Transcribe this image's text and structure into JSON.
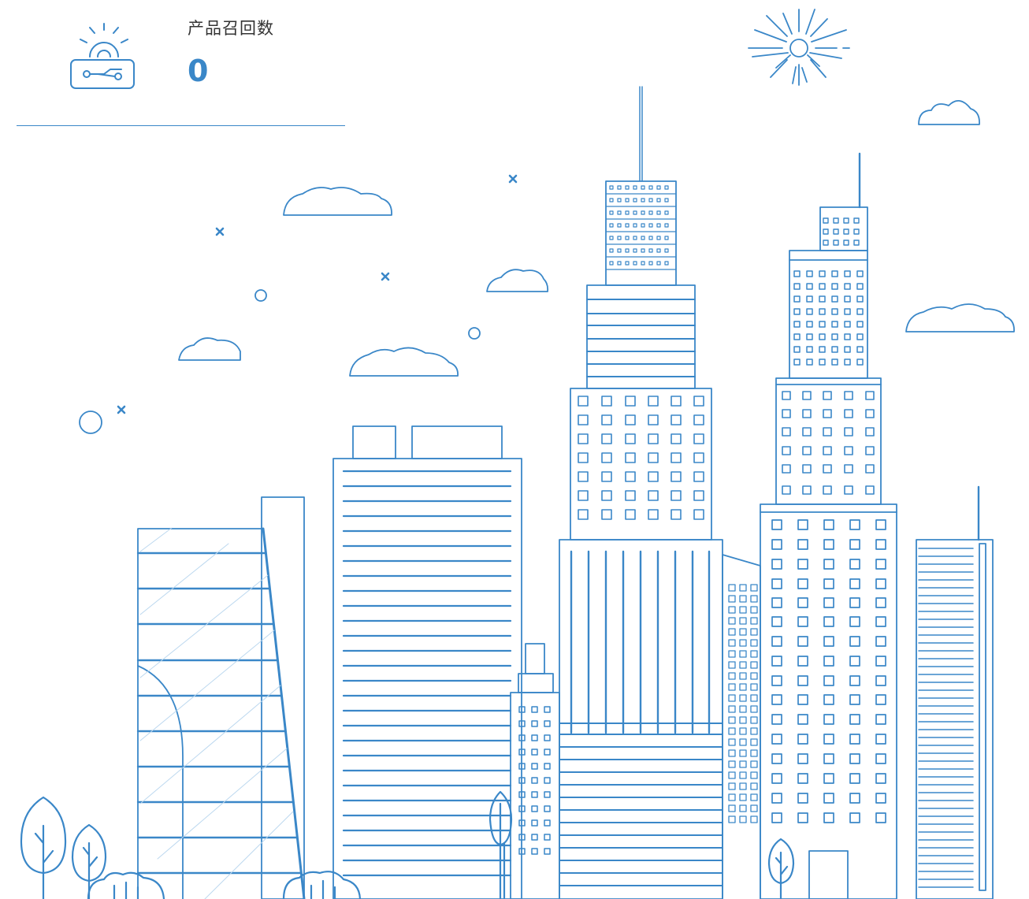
{
  "stat": {
    "label": "产品召回数",
    "value": "0",
    "icon": "gear-circuit-icon"
  },
  "colors": {
    "accent": "#3a87c8",
    "line": "#3a87c8",
    "text": "#333333"
  }
}
